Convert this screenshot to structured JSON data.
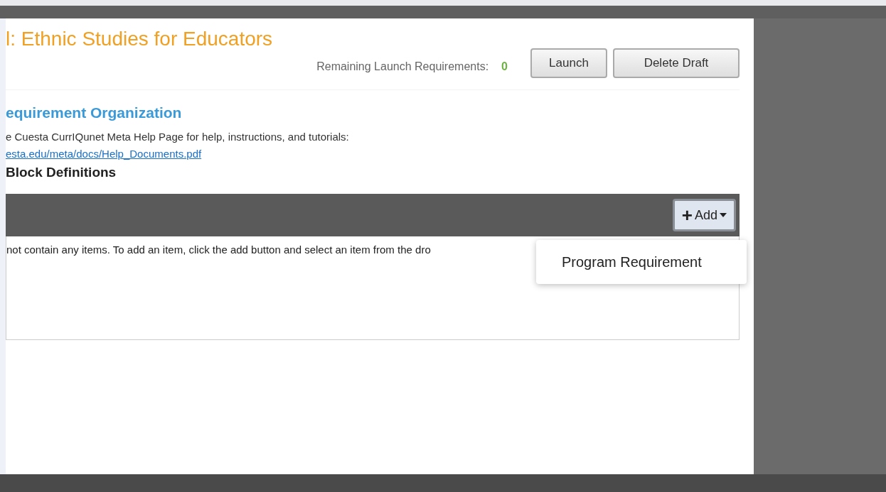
{
  "page_title": "l: Ethnic Studies for Educators",
  "header_buttons": [
    "Launch",
    "Delete Draft"
  ],
  "remaining": {
    "label": "Remaining Launch Requirements:",
    "count": "0"
  },
  "section": {
    "heading": "equirement Organization",
    "help_text": "e Cuesta CurrIQunet Meta Help Page for help, instructions, and tutorials:",
    "help_link": "esta.edu/meta/docs/Help_Documents.pdf",
    "subheading": "Block Definitions"
  },
  "list_panel": {
    "add_button": {
      "icon": "+",
      "label": "Add",
      "expanded": true
    },
    "empty_text": "not contain any items. To add an item, click the add button and select an item from the dro"
  },
  "dropdown": {
    "items": [
      {
        "label": "Program Requirement"
      }
    ]
  }
}
